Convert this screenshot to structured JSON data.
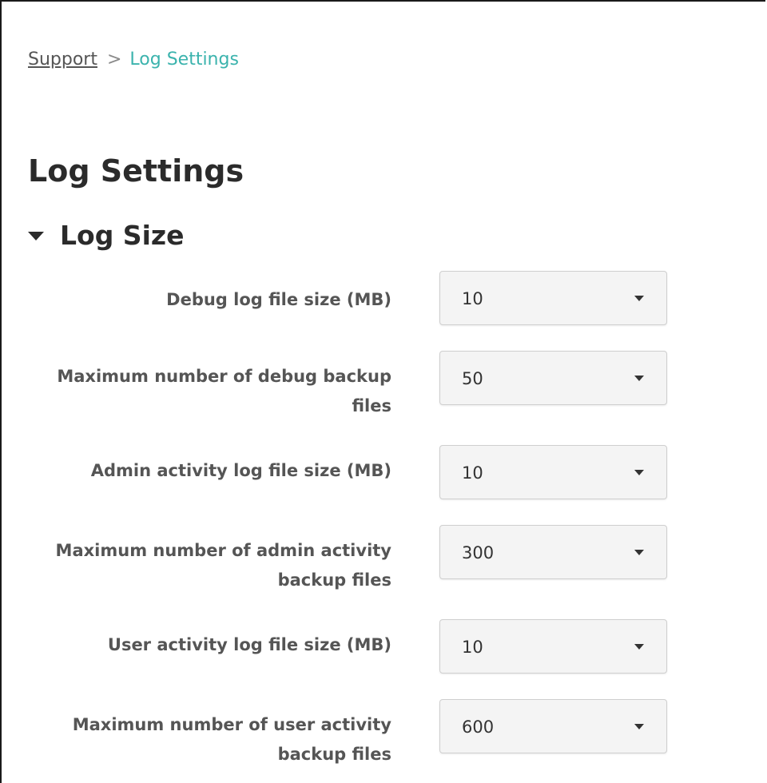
{
  "breadcrumb": {
    "parent": "Support",
    "separator": ">",
    "current": "Log Settings"
  },
  "page": {
    "title": "Log Settings"
  },
  "section": {
    "title": "Log Size",
    "expanded": true
  },
  "fields": [
    {
      "label": "Debug log file size (MB)",
      "value": "10"
    },
    {
      "label": "Maximum number of debug backup files",
      "value": "50"
    },
    {
      "label": "Admin activity log file size (MB)",
      "value": "10"
    },
    {
      "label": "Maximum number of admin activity backup files",
      "value": "300"
    },
    {
      "label": "User activity log file size (MB)",
      "value": "10"
    },
    {
      "label": "Maximum number of user activity backup files",
      "value": "600"
    }
  ],
  "colors": {
    "link": "#555555",
    "breadcrumb_current": "#3bb3ad",
    "label": "#555555",
    "select_bg": "#f4f4f4",
    "select_border": "#cfcfcf"
  },
  "icons": {
    "section_toggle": "triangle-down-icon",
    "dropdown": "chevron-down-icon"
  }
}
